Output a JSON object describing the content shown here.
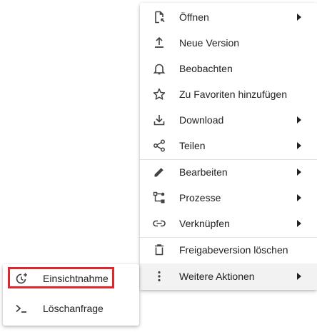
{
  "main_menu": {
    "items": [
      {
        "label": "Öffnen",
        "icon": "file-open-icon",
        "submenu": true
      },
      {
        "label": "Neue Version",
        "icon": "upload-icon",
        "submenu": false
      },
      {
        "label": "Beobachten",
        "icon": "bell-icon",
        "submenu": false
      },
      {
        "label": "Zu Favoriten hinzufügen",
        "icon": "star-icon",
        "submenu": false
      },
      {
        "label": "Download",
        "icon": "download-icon",
        "submenu": true
      },
      {
        "label": "Teilen",
        "icon": "share-icon",
        "submenu": true
      },
      {
        "label": "Bearbeiten",
        "icon": "pencil-icon",
        "submenu": true
      },
      {
        "label": "Prozesse",
        "icon": "process-icon",
        "submenu": true
      },
      {
        "label": "Verknüpfen",
        "icon": "link-icon",
        "submenu": true
      },
      {
        "label": "Freigabeversion löschen",
        "icon": "trash-icon",
        "submenu": false
      },
      {
        "label": "Weitere Aktionen",
        "icon": "more-vertical-icon",
        "submenu": true
      }
    ]
  },
  "sub_menu": {
    "items": [
      {
        "label": "Einsichtnahme",
        "icon": "history-add-icon"
      },
      {
        "label": "Löschanfrage",
        "icon": "terminal-icon"
      }
    ]
  },
  "colors": {
    "highlight": "#e0262b",
    "text": "#212121",
    "icon": "#424242",
    "active_background": "#f2f2f2"
  }
}
